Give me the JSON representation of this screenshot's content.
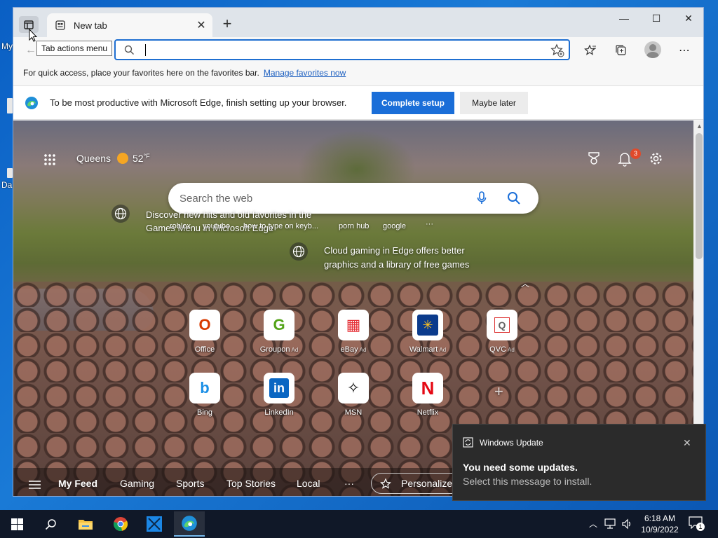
{
  "desktop": {
    "label_1": "My",
    "label_2": "Da"
  },
  "tabs": {
    "title": "New tab",
    "close": "✕",
    "new": "+"
  },
  "window_controls": {
    "minimize": "—",
    "maximize": "☐",
    "close": "✕"
  },
  "tooltip": "Tab actions menu",
  "address": {
    "value": ""
  },
  "favorites_bar": {
    "text": "For quick access, place your favorites here on the favorites bar.",
    "link": "Manage favorites now"
  },
  "setup_bar": {
    "message": "To be most productive with Microsoft Edge, finish setting up your browser.",
    "primary": "Complete setup",
    "secondary": "Maybe later"
  },
  "ntp": {
    "location": "Queens",
    "temperature": "52",
    "unit": "°F",
    "notification_count": "3",
    "search_placeholder": "Search the web",
    "promo_1": "Discover new hits and old favorites in the Games Menu in Microsoft Edge",
    "promo_2": "Cloud gaming in Edge offers better graphics and a library of free games",
    "suggestions": [
      "roblox",
      "youtube",
      "how to type on keyb...",
      "porn hub",
      "google",
      "···"
    ],
    "tiles": [
      {
        "label": "Office",
        "ad": "",
        "glyph": "O",
        "color": "#d83b01"
      },
      {
        "label": "Groupon",
        "ad": "Ad",
        "glyph": "G",
        "color": "#53a318"
      },
      {
        "label": "eBay",
        "ad": "Ad",
        "glyph": "▦",
        "color": "#e53238"
      },
      {
        "label": "Walmart",
        "ad": "Ad",
        "glyph": "✳",
        "color": "#ffc220"
      },
      {
        "label": "QVC",
        "ad": "Ad",
        "glyph": "Q",
        "color": "#666666"
      },
      {
        "label": "Bing",
        "ad": "",
        "glyph": "b",
        "color": "#1b8fe6"
      },
      {
        "label": "LinkedIn",
        "ad": "",
        "glyph": "in",
        "color": "#0a66c2"
      },
      {
        "label": "MSN",
        "ad": "",
        "glyph": "✧",
        "color": "#111111"
      },
      {
        "label": "Netflix",
        "ad": "",
        "glyph": "N",
        "color": "#e50914"
      }
    ],
    "feed": [
      "My Feed",
      "Gaming",
      "Sports",
      "Top Stories",
      "Local",
      "···"
    ],
    "personalize": "Personalize"
  },
  "toast": {
    "app": "Windows Update",
    "title": "You need some updates.",
    "body": "Select this message to install.",
    "close": "✕"
  },
  "clock": {
    "time": "6:18 AM",
    "date": "10/9/2022"
  },
  "action_center_count": "1"
}
